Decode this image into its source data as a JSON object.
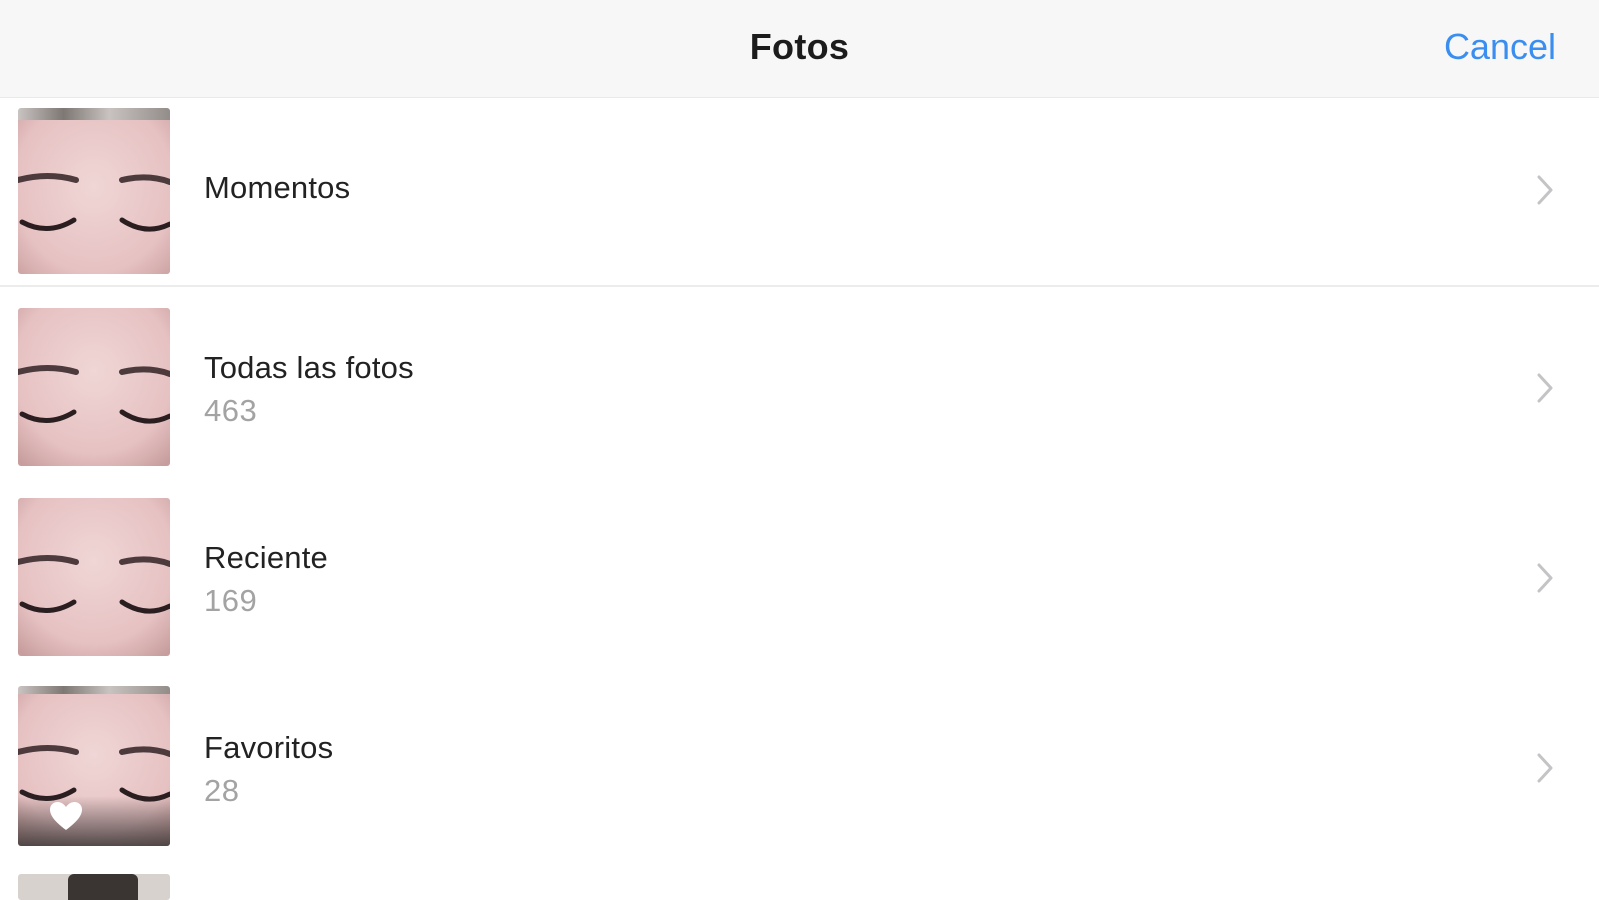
{
  "navbar": {
    "title": "Fotos",
    "cancel_label": "Cancel"
  },
  "albums": [
    {
      "name": "Momentos",
      "count": ""
    },
    {
      "name": "Todas las fotos",
      "count": "463"
    },
    {
      "name": "Reciente",
      "count": "169"
    },
    {
      "name": "Favoritos",
      "count": "28"
    }
  ],
  "colors": {
    "accent": "#3a8ef0",
    "navbar_bg": "#f7f7f7",
    "count_text": "#a3a3a3"
  },
  "icons": {
    "chevron": "chevron-right-icon",
    "favorite": "heart-icon"
  }
}
